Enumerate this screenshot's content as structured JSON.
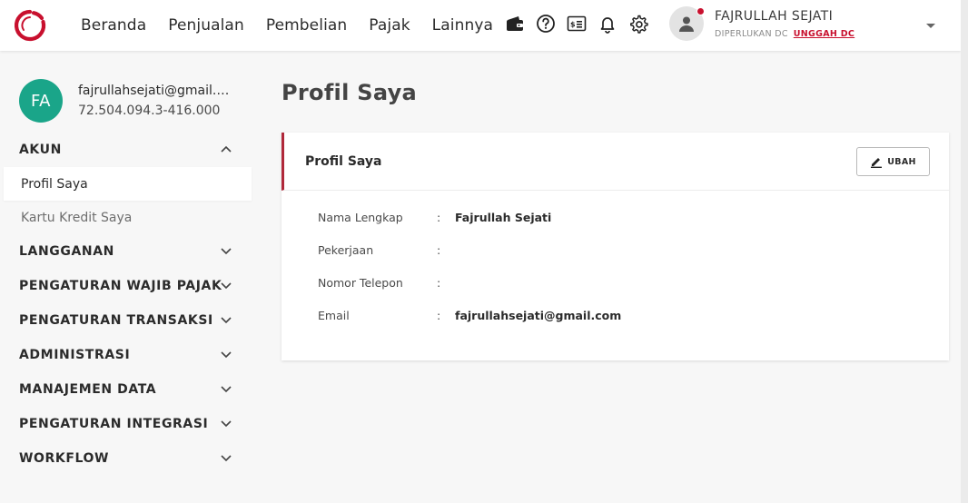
{
  "colors": {
    "brand": "#c8102e",
    "accent_teal": "#1aa589",
    "card_accent": "#b0283a"
  },
  "navbar": {
    "menu": [
      "Beranda",
      "Penjualan",
      "Pembelian",
      "Pajak",
      "Lainnya"
    ],
    "icons": [
      "wallet-icon",
      "help-icon",
      "id-card-icon",
      "bell-icon",
      "gear-icon"
    ],
    "user": {
      "name": "FAJRULLAH SEJATI",
      "sub_text": "DIPERLUKAN DC",
      "upload_link": "UNGGAH DC"
    }
  },
  "sidebar": {
    "avatar_initials": "FA",
    "email": "fajrullahsejati@gmail.com",
    "npwp": "72.504.094.3-416.000",
    "sections": [
      {
        "label": "AKUN",
        "expanded": true,
        "items": [
          {
            "label": "Profil Saya",
            "active": true
          },
          {
            "label": "Kartu Kredit Saya",
            "active": false
          }
        ]
      },
      {
        "label": "LANGGANAN",
        "expanded": false
      },
      {
        "label": "PENGATURAN WAJIB PAJAK",
        "expanded": false
      },
      {
        "label": "PENGATURAN TRANSAKSI",
        "expanded": false
      },
      {
        "label": "ADMINISTRASI",
        "expanded": false
      },
      {
        "label": "MANAJEMEN DATA",
        "expanded": false
      },
      {
        "label": "PENGATURAN INTEGRASI",
        "expanded": false
      },
      {
        "label": "WORKFLOW",
        "expanded": false
      }
    ]
  },
  "main": {
    "page_title": "Profil Saya",
    "card": {
      "title": "Profil Saya",
      "edit_label": "UBAH",
      "fields": [
        {
          "label": "Nama Lengkap",
          "value": "Fajrullah Sejati"
        },
        {
          "label": "Pekerjaan",
          "value": ""
        },
        {
          "label": "Nomor Telepon",
          "value": ""
        },
        {
          "label": "Email",
          "value": "fajrullahsejati@gmail.com"
        }
      ],
      "separator": ":"
    }
  }
}
